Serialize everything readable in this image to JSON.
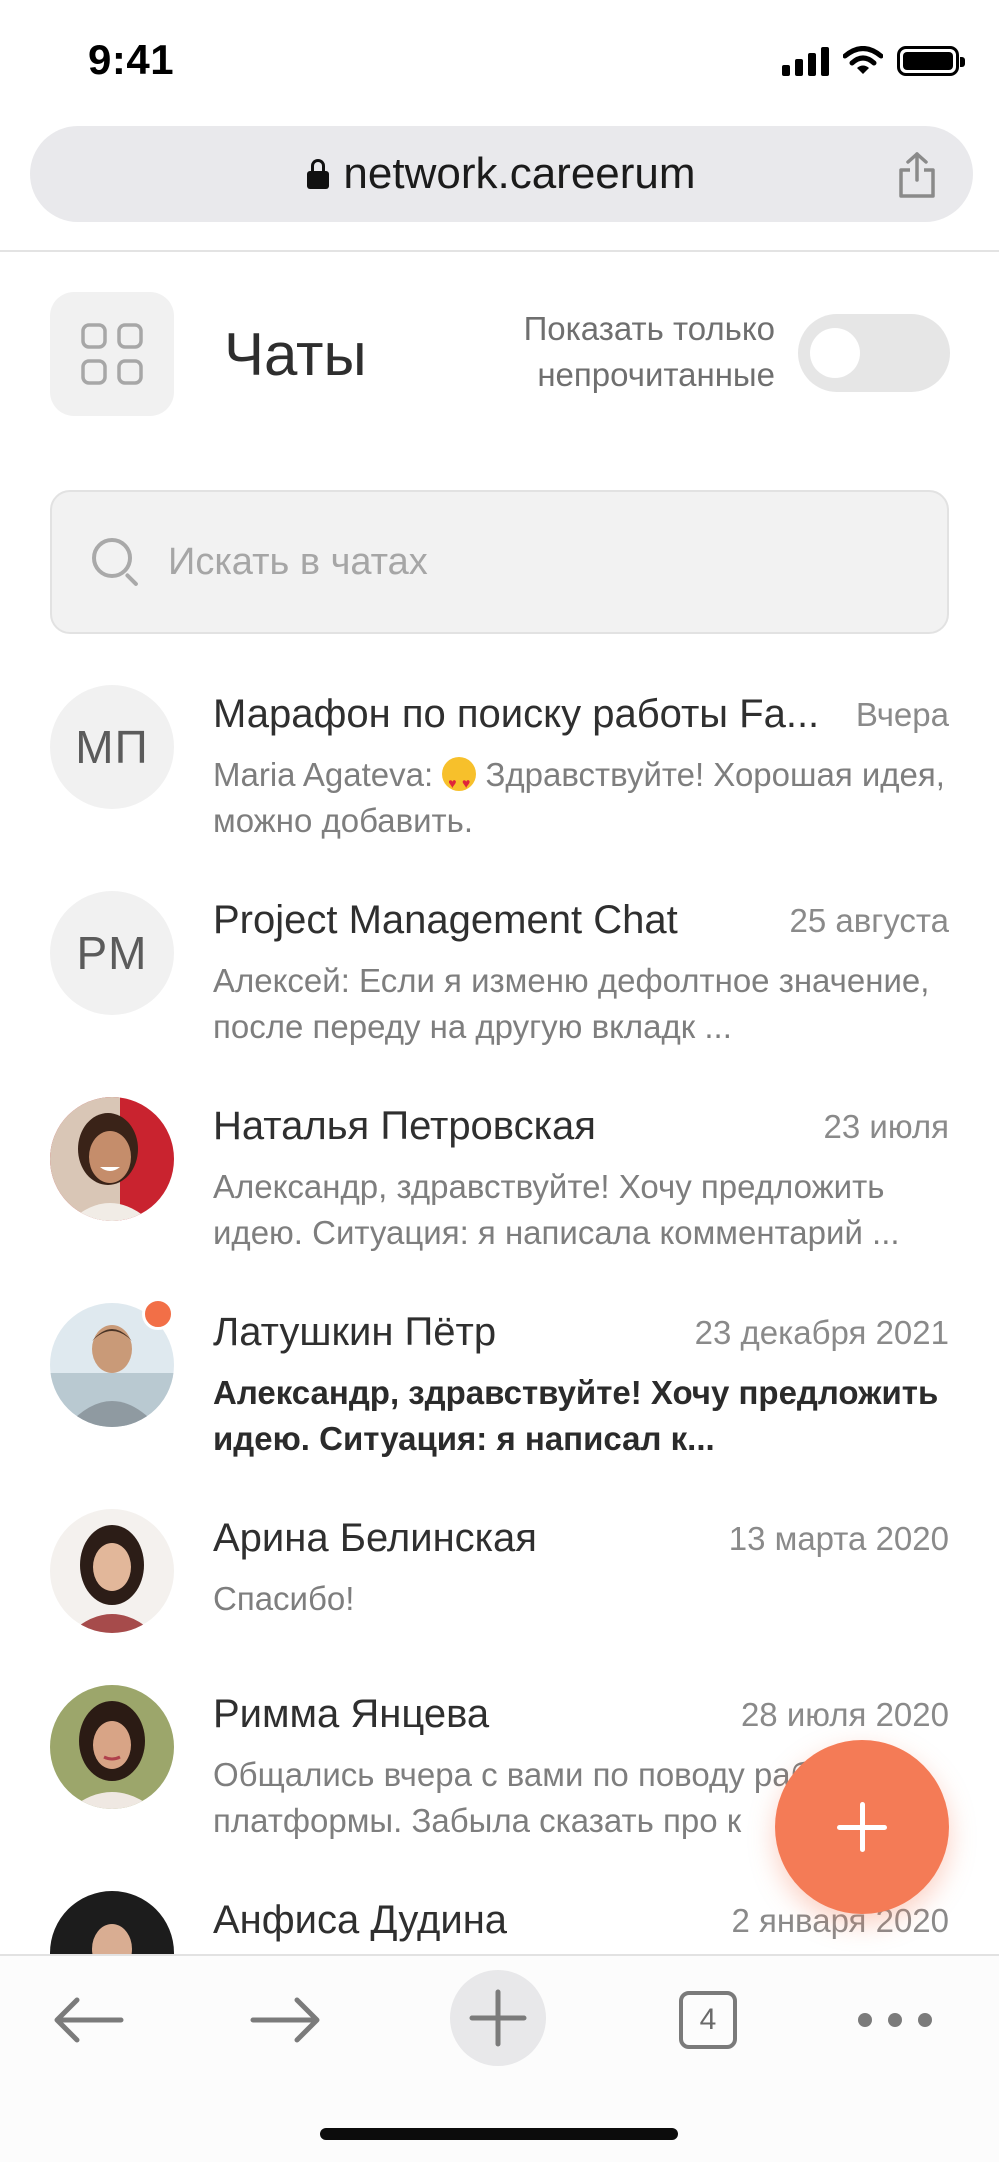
{
  "status_bar": {
    "time": "9:41"
  },
  "browser": {
    "url": "network.careerum",
    "tabs_count": "4"
  },
  "header": {
    "title": "Чаты",
    "toggle_label_line1": "Показать только",
    "toggle_label_line2": "непрочитанные",
    "unread_only": false
  },
  "search": {
    "placeholder": "Искать в чатах"
  },
  "chats": [
    {
      "name": "Марафон по поиску работы Fa...",
      "date": "Вчера",
      "initials": "МП",
      "preview_sender": "Maria Agateva: ",
      "preview_emoji": "heart-eyes-emoji",
      "preview_text": " Здравствуйте! Хорошая идея, можно добавить.",
      "unread": false
    },
    {
      "name": "Project Management Chat",
      "date": "25 августа",
      "initials": "PM",
      "preview": "Алексей: Если я изменю дефолтное значение, после переду на другую вкладк ...",
      "unread": false
    },
    {
      "name": "Наталья Петровская",
      "date": "23 июля",
      "preview": "Александр, здравствуйте! Хочу предложить идею. Ситуация: я написала комментарий ...",
      "unread": false
    },
    {
      "name": "Латушкин Пётр",
      "date": "23 декабря 2021",
      "preview": "Александр, здравствуйте! Хочу предложить идею. Ситуация: я написал к...",
      "unread": true
    },
    {
      "name": "Арина Белинская",
      "date": "13 марта 2020",
      "preview": "Спасибо!",
      "unread": false
    },
    {
      "name": "Римма Янцева",
      "date": "28 июля 2020",
      "preview": "Общались вчера с вами по поводу работы платформы. Забыла сказать про к",
      "unread": false
    },
    {
      "name": "Анфиса Дудина",
      "date": "2 января 2020",
      "preview": "",
      "unread": false
    }
  ],
  "colors": {
    "accent": "#f47b56",
    "unread_dot": "#f26f47",
    "muted_text": "#7e7e7e"
  }
}
